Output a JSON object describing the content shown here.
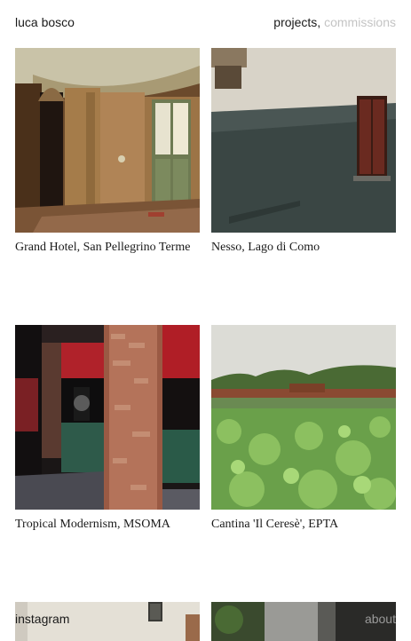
{
  "header": {
    "brand": "luca bosco",
    "nav_projects": "projects,",
    "nav_commissions": "commissions"
  },
  "projects": [
    {
      "title": "Grand Hotel, San Pellegrino Terme"
    },
    {
      "title": "Nesso, Lago di Como"
    },
    {
      "title": "Tropical Modernism, MSOMA"
    },
    {
      "title": "Cantina 'Il Ceresè', EPTA"
    },
    {
      "title": ""
    },
    {
      "title": ""
    }
  ],
  "footer": {
    "instagram": "instagram",
    "about": "about"
  },
  "colors": {
    "text": "#1a1a1a",
    "muted": "#c4c4c4",
    "background": "#ffffff"
  }
}
